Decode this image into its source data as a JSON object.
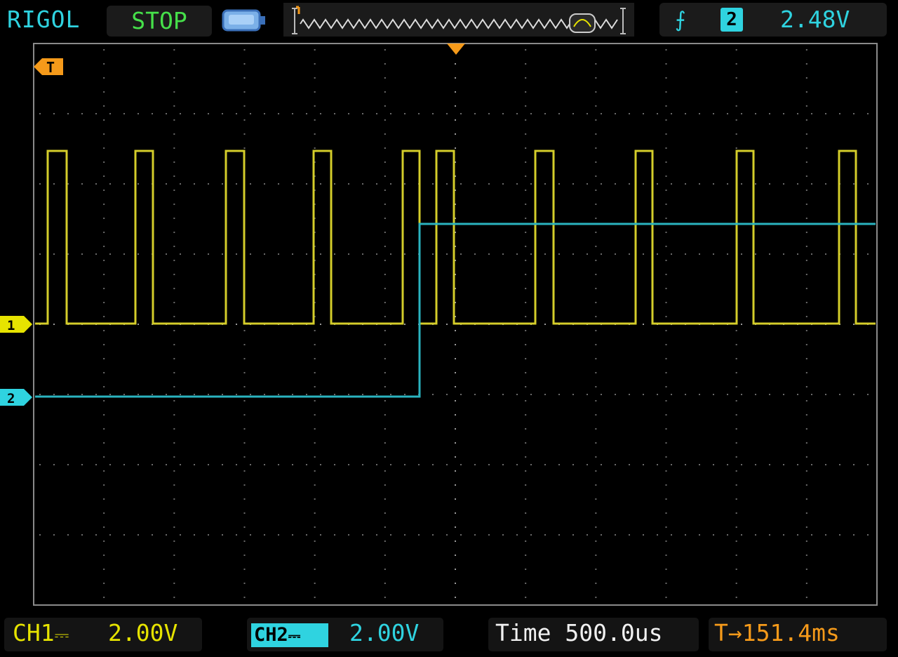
{
  "header": {
    "brand": "RIGOL",
    "run_status": "STOP",
    "trigger_edge_icon": "rising-edge-icon",
    "trigger_source": "2",
    "trigger_level": "2.48V"
  },
  "markers": {
    "trigger_time_marker": "T",
    "ch1_marker": "1",
    "ch2_marker": "2"
  },
  "footer": {
    "ch1_label": "CH1",
    "ch1_coupling_icon": "dc-coupling-icon",
    "ch1_scale": "2.00V",
    "ch2_label": "CH2",
    "ch2_coupling_icon": "dc-coupling-icon",
    "ch2_scale": "2.00V",
    "time_label": "Time",
    "time_scale": "500.0us",
    "delay_icon": "trigger-delay-icon",
    "trigger_delay": "151.4ms"
  },
  "colors": {
    "ch1": "#d4cd2a",
    "ch2": "#2ab3bf",
    "accent": "#2fd3e0",
    "trigger": "#f59a1a",
    "grid": "#7a7a7a",
    "status": "#46e04a"
  }
}
